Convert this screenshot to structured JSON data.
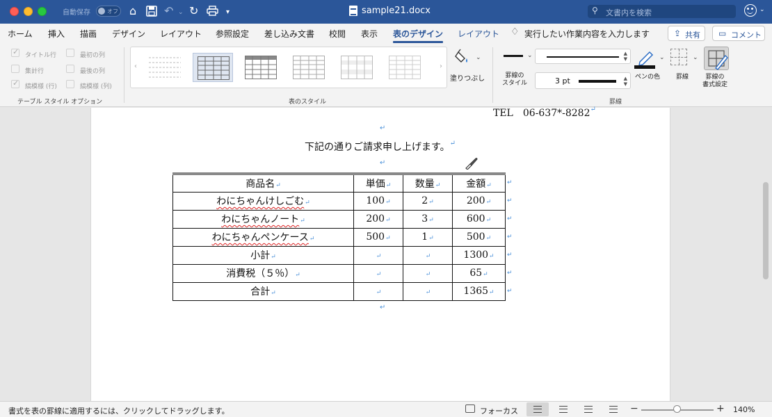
{
  "window": {
    "autosave_label": "自動保存",
    "autosave_state": "オフ",
    "doc_title": "sample21.docx",
    "search_placeholder": "文書内を検索"
  },
  "tabs": [
    {
      "label": "ホーム"
    },
    {
      "label": "挿入"
    },
    {
      "label": "描画"
    },
    {
      "label": "デザイン"
    },
    {
      "label": "レイアウト"
    },
    {
      "label": "参照設定"
    },
    {
      "label": "差し込み文書"
    },
    {
      "label": "校閲"
    },
    {
      "label": "表示"
    },
    {
      "label": "表のデザイン",
      "active": true
    },
    {
      "label": "レイアウト"
    }
  ],
  "tell_me": "実行したい作業内容を入力します",
  "share_label": "共有",
  "comment_label": "コメント",
  "style_options": {
    "items": [
      {
        "label": "タイトル行",
        "checked": true
      },
      {
        "label": "最初の列",
        "checked": false
      },
      {
        "label": "集計行",
        "checked": false
      },
      {
        "label": "最後の列",
        "checked": false
      },
      {
        "label": "縞模様 (行)",
        "checked": true
      },
      {
        "label": "縞模様 (列)",
        "checked": false
      }
    ],
    "group_label": "テーブル スタイル オプション"
  },
  "table_styles": {
    "group_label": "表のスタイル"
  },
  "shading_label": "塗りつぶし",
  "borders": {
    "line_style_label": "罫線の\nスタイル",
    "weight": "3 pt",
    "pen_color_label": "ペンの色",
    "pen_color": "#111111",
    "border_label": "罫線",
    "painter_label": "罫線の\n書式設定",
    "group_label": "罫線"
  },
  "document": {
    "tel": "TEL　06-637*-8282",
    "intro": "下記の通りご請求申し上げます。",
    "table": {
      "headers": [
        "商品名",
        "単価",
        "数量",
        "金額"
      ],
      "rows": [
        [
          "わにちゃんけしごむ",
          "100",
          "2",
          "200"
        ],
        [
          "わにちゃんノート",
          "200",
          "3",
          "600"
        ],
        [
          "わにちゃんペンケース",
          "500",
          "1",
          "500"
        ],
        [
          "小計",
          "",
          "",
          "1300"
        ],
        [
          "消費税（５％）",
          "",
          "",
          "65"
        ],
        [
          "合計",
          "",
          "",
          "1365"
        ]
      ]
    }
  },
  "status": {
    "message": "書式を表の罫線に適用するには、クリックしてドラッグします。",
    "focus_label": "フォーカス",
    "zoom": "140%",
    "zoom_fraction": 0.5
  }
}
